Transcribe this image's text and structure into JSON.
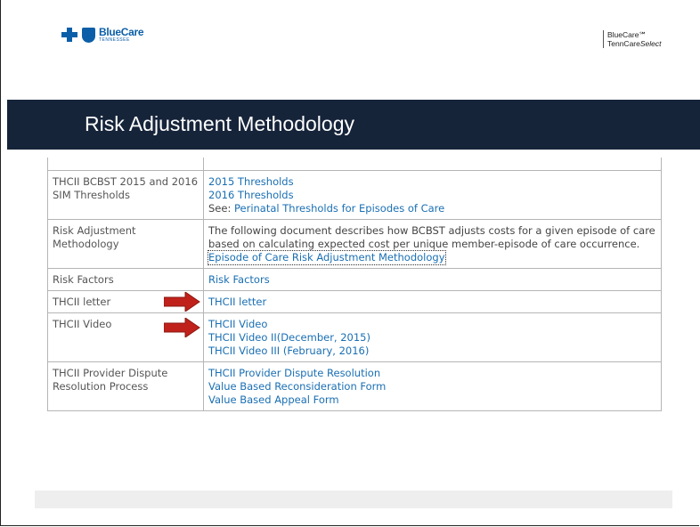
{
  "header": {
    "logo_name": "BlueCare",
    "logo_sub": "TENNESSEE",
    "brand_line1": "BlueCare℠",
    "brand_line2_a": "TennCare",
    "brand_line2_b": "Select"
  },
  "title": "Risk Adjustment Methodology",
  "rows": [
    {
      "label": "THCII BCBST 2015 and 2016 SIM Thresholds",
      "links": [
        "2015 Thresholds",
        "2016 Thresholds"
      ],
      "see_prefix": "See: ",
      "see_link": "Perinatal Thresholds for Episodes of Care"
    },
    {
      "label": "Risk Adjustment Methodology",
      "description": "The following document describes how BCBST adjusts costs for a given episode of care based on calculating expected cost per unique member-episode of care occurrence.",
      "link": "Episode of Care Risk Adjustment Methodology"
    },
    {
      "label": "Risk Factors",
      "link": "Risk Factors"
    },
    {
      "label": "THCII letter",
      "link": "THCII letter"
    },
    {
      "label": "THCII Video",
      "links": [
        "THCII Video",
        "THCII Video II(December, 2015)",
        "THCII Video III (February, 2016)"
      ]
    },
    {
      "label": "THCII Provider Dispute Resolution Process",
      "links": [
        "THCII Provider Dispute Resolution",
        "Value Based Reconsideration Form",
        "Value Based Appeal Form"
      ]
    }
  ],
  "colors": {
    "title_bar": "#16243a",
    "link": "#1a6fb3",
    "arrow": "#c0221b",
    "brand": "#0b5fa8"
  }
}
